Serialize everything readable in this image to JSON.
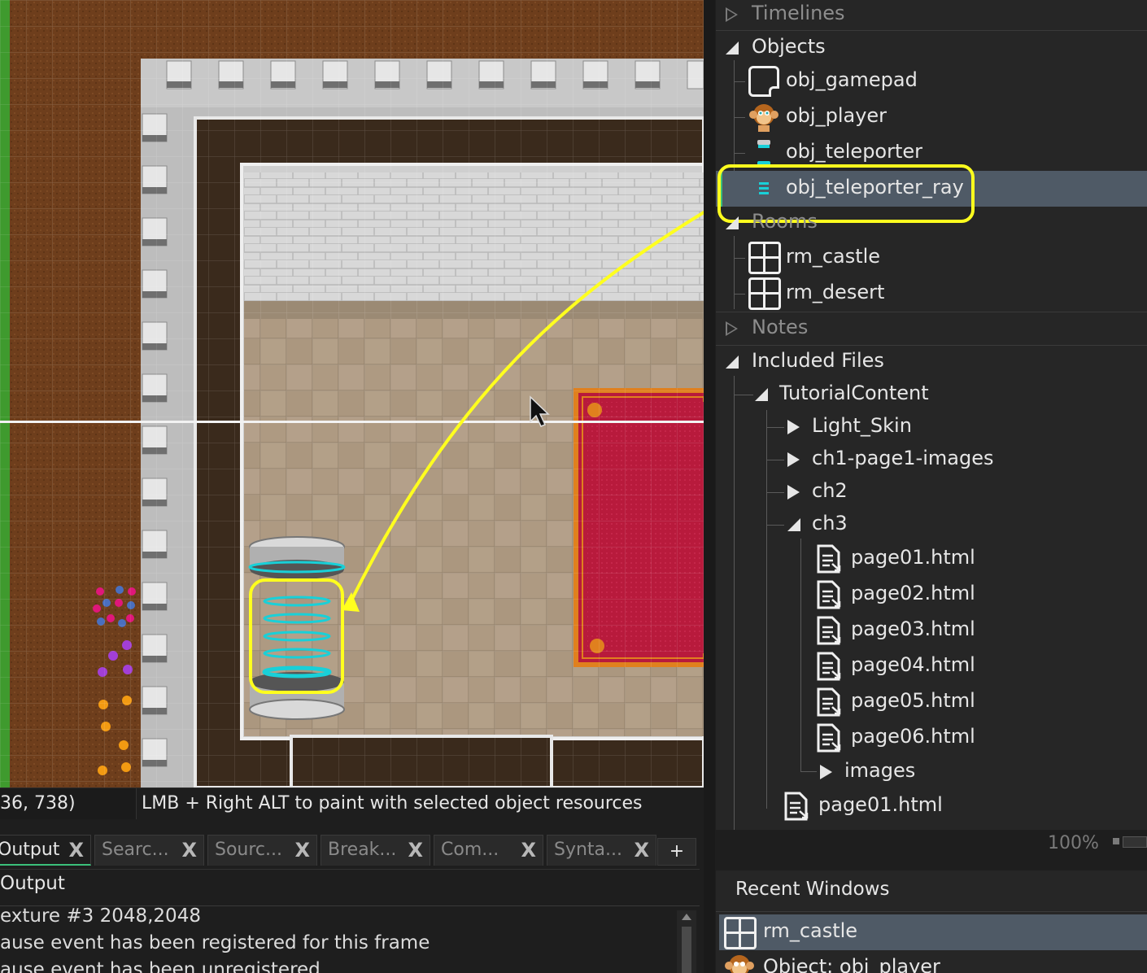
{
  "status": {
    "coords": "36, 738)",
    "hint": "LMB + Right ALT to paint with selected object resources"
  },
  "tabs": [
    {
      "label": "Output",
      "close": "X"
    },
    {
      "label": "Searc...",
      "close": "X"
    },
    {
      "label": "Sourc...",
      "close": "X"
    },
    {
      "label": "Break...",
      "close": "X"
    },
    {
      "label": "Com...",
      "close": "X"
    },
    {
      "label": "Synta...",
      "close": "X"
    }
  ],
  "tab_add": "+",
  "output": {
    "title": "Output",
    "lines": [
      "exture #3 2048,2048",
      "ause event has been registered for this frame",
      "ause event has been unregistered"
    ]
  },
  "tree": {
    "timelines": "Timelines",
    "objects": "Objects",
    "obj_gamepad": "obj_gamepad",
    "obj_player": "obj_player",
    "obj_teleporter": "obj_teleporter",
    "obj_teleporter_ray": "obj_teleporter_ray",
    "rooms": "Rooms",
    "rm_castle": "rm_castle",
    "rm_desert": "rm_desert",
    "notes": "Notes",
    "included_files": "Included Files",
    "tutorial_content": "TutorialContent",
    "light_skin": "Light_Skin",
    "ch1_page1_images": "ch1-page1-images",
    "ch2": "ch2",
    "ch3": "ch3",
    "page01": "page01.html",
    "page02": "page02.html",
    "page03": "page03.html",
    "page04": "page04.html",
    "page05": "page05.html",
    "page06": "page06.html",
    "images": "images",
    "page01_root": "page01.html"
  },
  "zoom": "100%",
  "recent": {
    "title": "Recent Windows",
    "items": [
      "rm_castle",
      "Object: obj_player"
    ]
  },
  "colors": {
    "highlight": "#ffff1e",
    "selection": "#4f5a66",
    "teleporter_cyan": "#19d0d8",
    "carpet": "#b81a3c"
  }
}
